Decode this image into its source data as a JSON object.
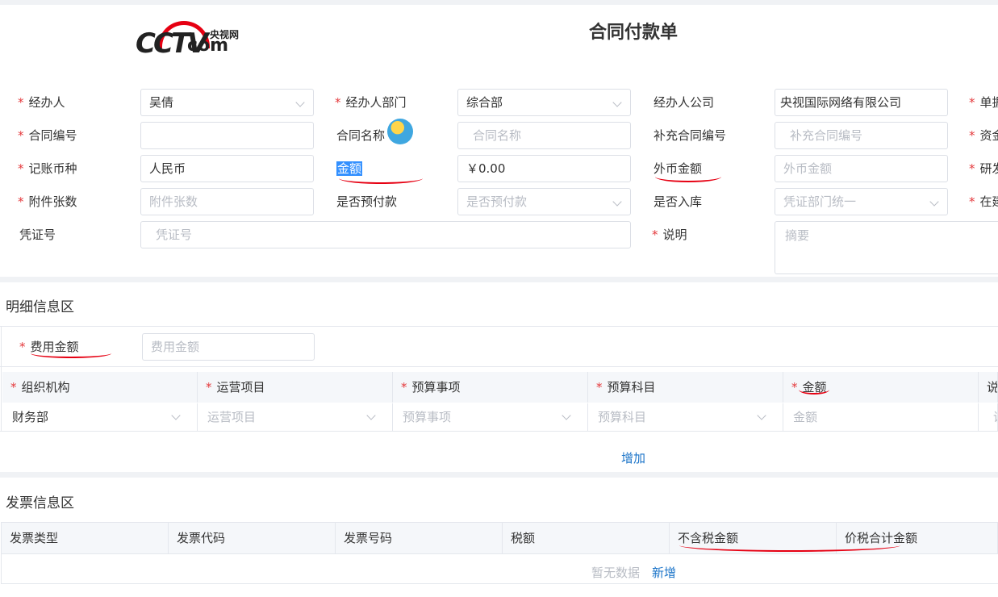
{
  "header": {
    "logo_cn": "央视网",
    "logo_com": "com",
    "title": "合同付款单"
  },
  "form": {
    "r1": {
      "handler_label": "经办人",
      "handler_value": "吴倩",
      "dept_label": "经办人部门",
      "dept_value": "综合部",
      "company_label": "经办人公司",
      "company_value": "央视国际网络有限公司",
      "right_label": "单据"
    },
    "r2": {
      "contract_no_label": "合同编号",
      "contract_name_label": "合同名称",
      "contract_name_ph": "合同名称",
      "supp_no_label": "补充合同编号",
      "supp_no_ph": "补充合同编号",
      "right_label": "资金"
    },
    "r3": {
      "currency_label": "记账币种",
      "currency_value": "人民币",
      "amount_label": "金额",
      "amount_value": "￥0.00",
      "foreign_label": "外币金额",
      "foreign_ph": "外币金额",
      "right_label": "研发"
    },
    "r4": {
      "attach_label": "附件张数",
      "attach_ph": "附件张数",
      "prepay_label": "是否预付款",
      "prepay_ph": "是否预付款",
      "stock_label": "是否入库",
      "stock_ph": "凭证部门统一",
      "right_label": "在建"
    },
    "r5": {
      "voucher_label": "凭证号",
      "voucher_ph": "凭证号",
      "desc_label": "说明",
      "desc_ph": "摘要"
    }
  },
  "detail": {
    "section_title": "明细信息区",
    "fee_label": "费用金额",
    "fee_ph": "费用金额",
    "columns": [
      "组织机构",
      "运营项目",
      "预算事项",
      "预算科目",
      "金额",
      "说明"
    ],
    "row": [
      "财务部",
      "运营项目",
      "预算事项",
      "预算科目",
      "金额",
      "说"
    ],
    "add_label": "增加"
  },
  "invoice": {
    "section_title": "发票信息区",
    "columns": [
      "发票类型",
      "发票代码",
      "发票号码",
      "税额",
      "不含税金额",
      "价税合计金额"
    ],
    "empty_text": "暂无数据",
    "new_label": "新增"
  },
  "colors": {
    "required": "#e4393c",
    "link": "#1a73c8",
    "highlight": "#3390ff",
    "annotation": "#e60012"
  }
}
